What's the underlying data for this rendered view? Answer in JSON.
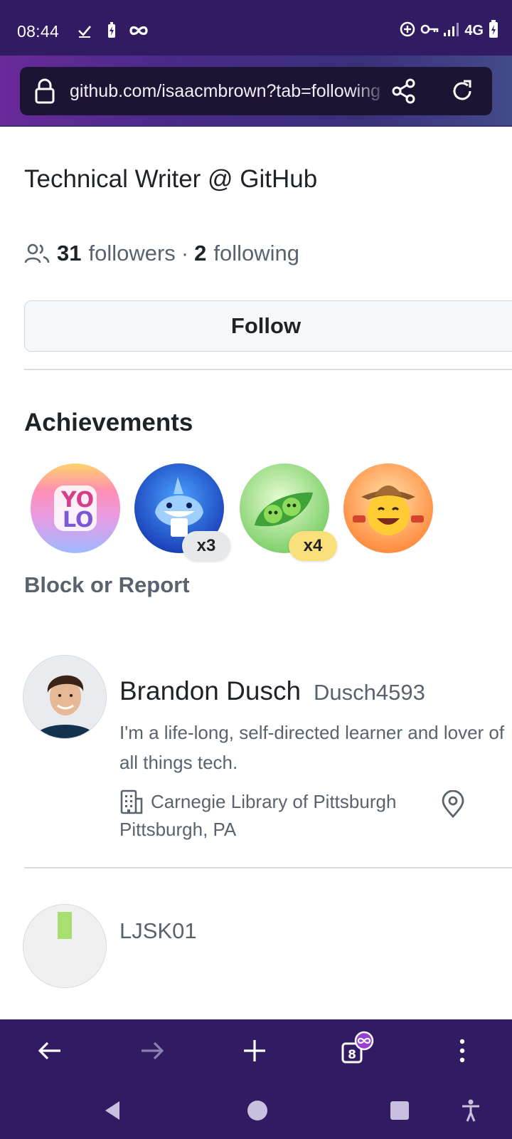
{
  "status_bar": {
    "time": "08:44",
    "network": "4G",
    "icons": [
      "check-icon",
      "battery-saver-icon",
      "infinity-icon",
      "data-saver-icon",
      "vpn-key-icon",
      "signal-icon",
      "battery-charging-icon"
    ]
  },
  "browser": {
    "url": "github.com/isaacmbrown?tab=following",
    "theme_color": "#311b62",
    "tab_count": "8"
  },
  "profile": {
    "bio": "Technical Writer @ GitHub",
    "followers_count": "31",
    "followers_label": "followers",
    "separator": "·",
    "following_count": "2",
    "following_label": "following",
    "follow_button": "Follow",
    "achievements_title": "Achievements",
    "achievements": [
      {
        "name": "yolo",
        "multiplier": ""
      },
      {
        "name": "pull-shark",
        "multiplier": "x3"
      },
      {
        "name": "pair-extraordinaire",
        "multiplier": "x4"
      },
      {
        "name": "quickdraw",
        "multiplier": ""
      }
    ],
    "block_report": "Block or Report"
  },
  "following_list": [
    {
      "name": "Brandon Dusch",
      "login": "Dusch4593",
      "bio": "I'm a life-long, self-directed learner and lover of all things tech.",
      "company": "Carnegie Library of Pittsburgh",
      "location": "Pittsburgh, PA"
    },
    {
      "name": "",
      "login": "LJSK01"
    }
  ]
}
